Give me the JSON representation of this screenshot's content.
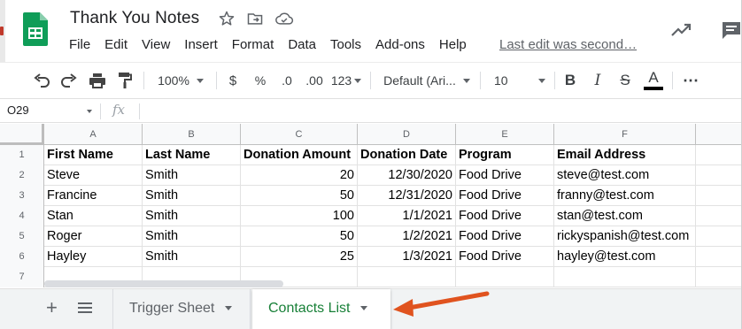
{
  "colors": {
    "sheets_green": "#0f9d58",
    "active_tab_text": "#188038",
    "arrow": "#e0531f",
    "header_bg": "#f8f9fa"
  },
  "document": {
    "title": "Thank You Notes",
    "icons": [
      "star-icon",
      "move-to-folder-icon",
      "cloud-status-icon"
    ]
  },
  "menu": {
    "items": [
      "File",
      "Edit",
      "View",
      "Insert",
      "Format",
      "Data",
      "Tools",
      "Add-ons",
      "Help"
    ],
    "last_edit": "Last edit was second…"
  },
  "toolbar": {
    "zoom": "100%",
    "currency": "$",
    "percent": "%",
    "decrease_decimal": ".0",
    "increase_decimal": ".00",
    "more_formats": "123",
    "font": "Default (Ari...",
    "font_size": "10",
    "bold": "B",
    "italic": "I",
    "strikethrough": "S",
    "text_color": "A",
    "more": "⋯"
  },
  "formula_bar": {
    "cell_ref": "O29",
    "fx": "fx",
    "value": ""
  },
  "sheet": {
    "columns": [
      "A",
      "B",
      "C",
      "D",
      "E",
      "F"
    ],
    "rows": [
      {
        "n": "1",
        "cells": [
          "First Name",
          "Last Name",
          "Donation Amount",
          "Donation Date",
          "Program",
          "Email Address"
        ]
      },
      {
        "n": "2",
        "cells": [
          "Steve",
          "Smith",
          "20",
          "12/30/2020",
          "Food Drive",
          "steve@test.com"
        ]
      },
      {
        "n": "3",
        "cells": [
          "Francine",
          "Smith",
          "50",
          "12/31/2020",
          "Food Drive",
          "franny@test.com"
        ]
      },
      {
        "n": "4",
        "cells": [
          "Stan",
          "Smith",
          "100",
          "1/1/2021",
          "Food Drive",
          "stan@test.com"
        ]
      },
      {
        "n": "5",
        "cells": [
          "Roger",
          "Smith",
          "50",
          "1/2/2021",
          "Food Drive",
          "rickyspanish@test.com"
        ]
      },
      {
        "n": "6",
        "cells": [
          "Hayley",
          "Smith",
          "25",
          "1/3/2021",
          "Food Drive",
          "hayley@test.com"
        ]
      },
      {
        "n": "7",
        "cells": [
          "",
          "",
          "",
          "",
          "",
          ""
        ]
      }
    ]
  },
  "tabs": {
    "add": "+",
    "sheets": [
      {
        "name": "Trigger Sheet",
        "active": false
      },
      {
        "name": "Contacts List",
        "active": true
      }
    ]
  }
}
